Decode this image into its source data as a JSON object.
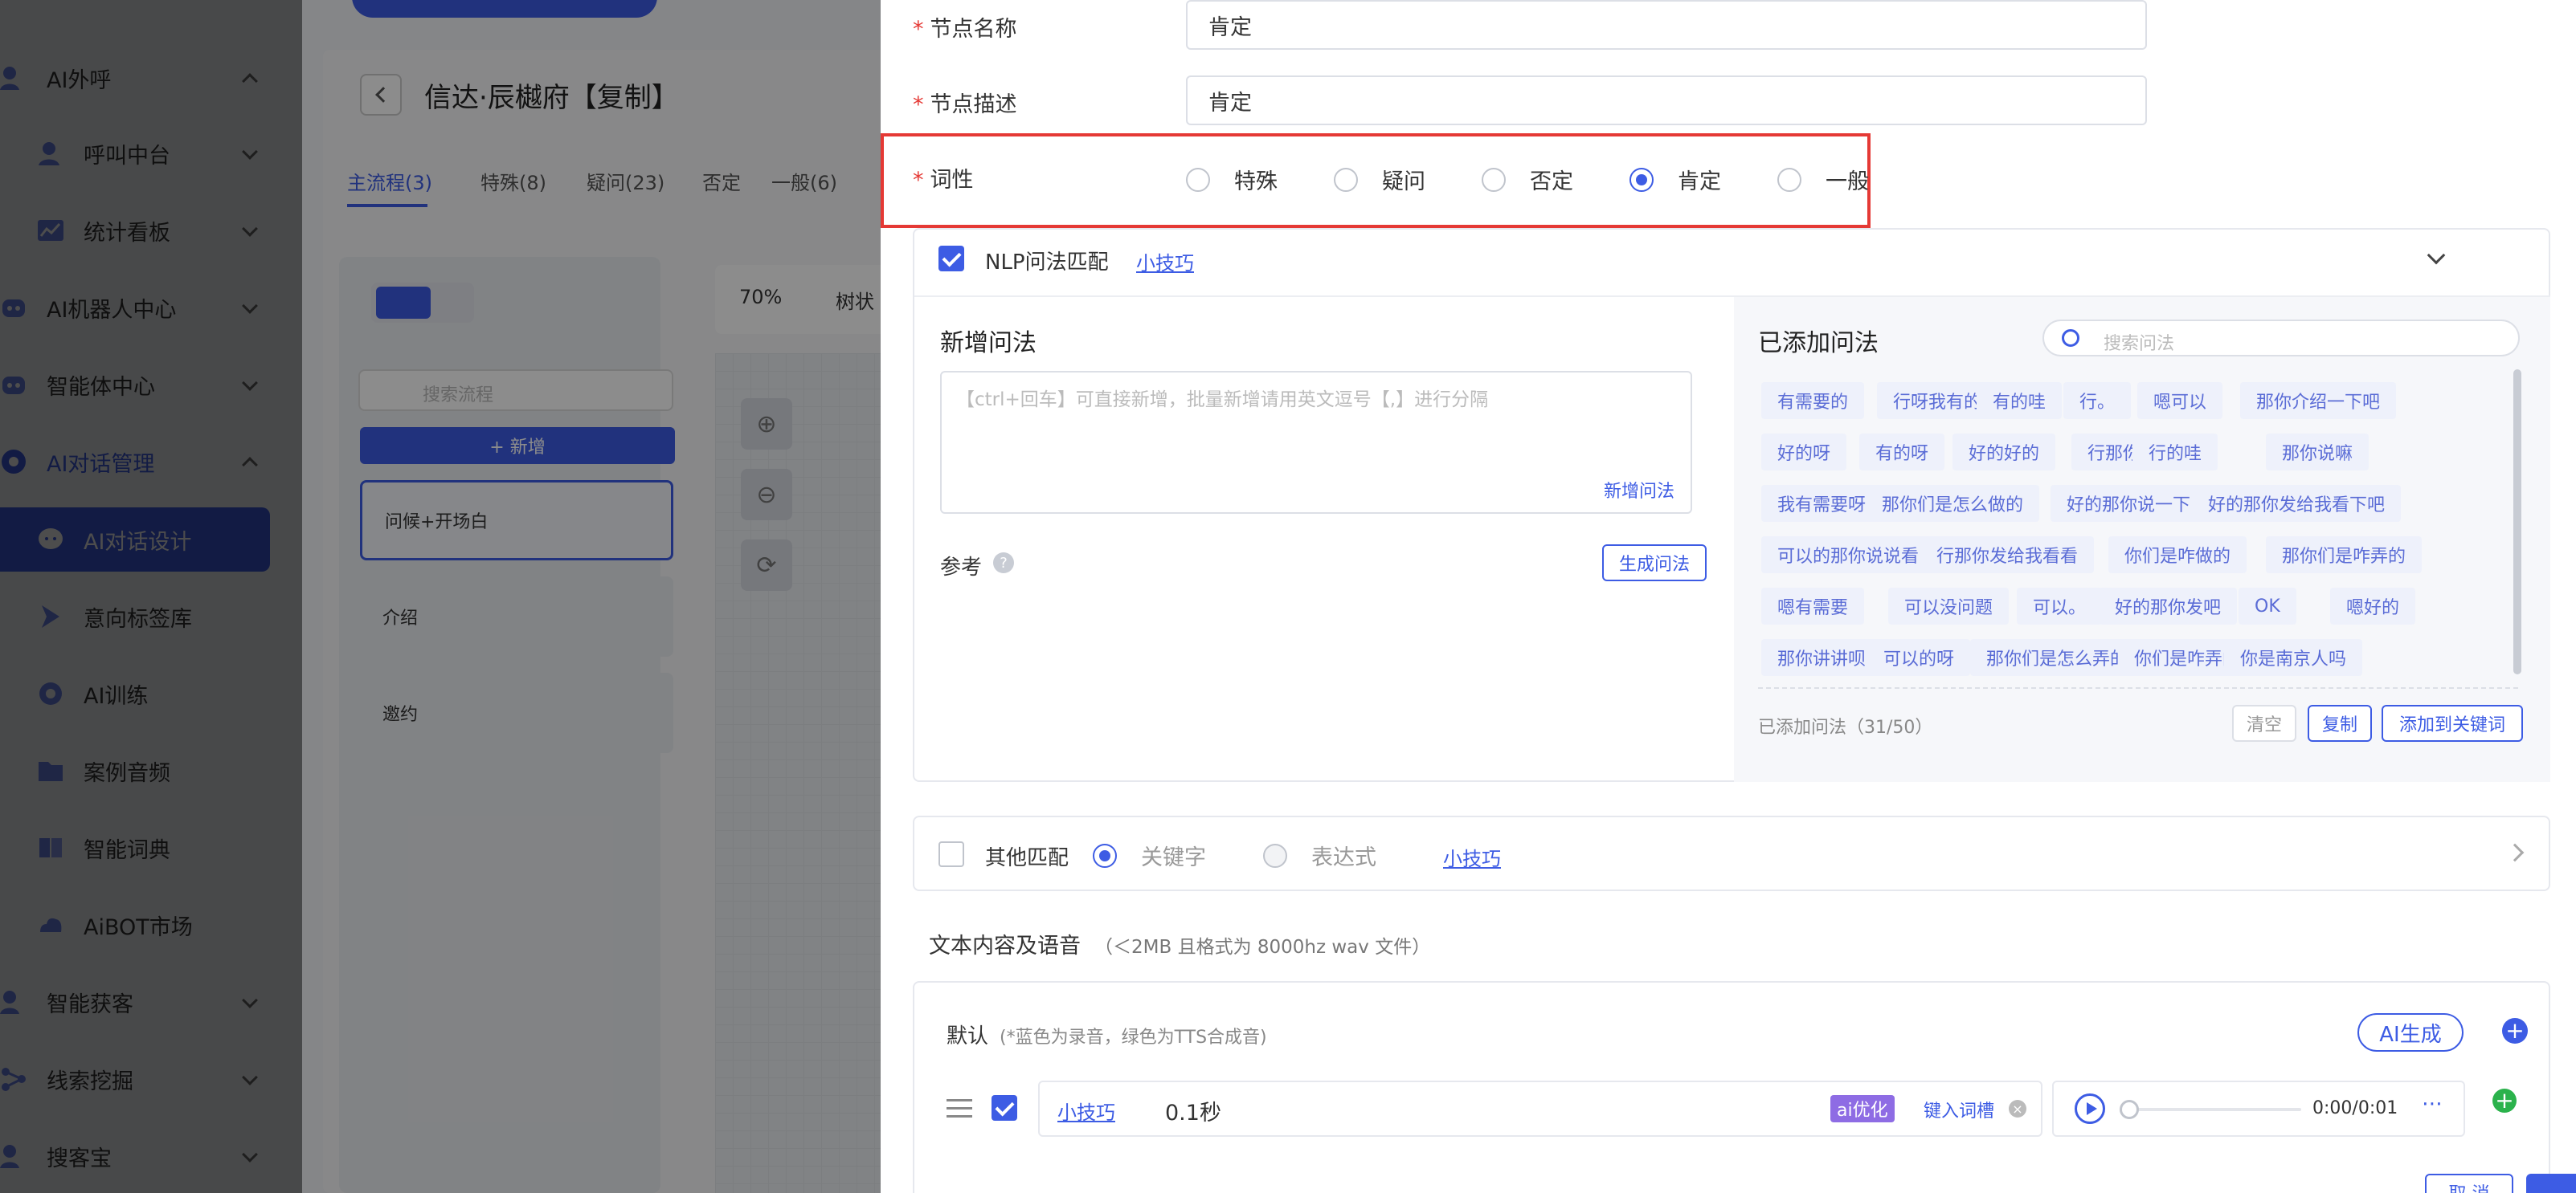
{
  "sidebar": {
    "items": [
      {
        "label": "AI外呼",
        "icon": "user-phone-icon",
        "expanded": true
      },
      {
        "label": "呼叫中台",
        "icon": "user-headset-icon",
        "expanded": false
      },
      {
        "label": "统计看板",
        "icon": "chart-board-icon",
        "expanded": false
      },
      {
        "label": "AI机器人中心",
        "icon": "robot-icon",
        "expanded": false
      },
      {
        "label": "智能体中心",
        "icon": "agent-icon",
        "expanded": false
      },
      {
        "label": "AI对话管理",
        "icon": "dialog-manage-icon",
        "expanded": true
      },
      {
        "label": "AI对话设计",
        "icon": "chat-bubble-icon",
        "active": true
      },
      {
        "label": "意向标签库",
        "icon": "tag-icon"
      },
      {
        "label": "AI训练",
        "icon": "gear-brain-icon"
      },
      {
        "label": "案例音频",
        "icon": "folder-audio-icon"
      },
      {
        "label": "智能词典",
        "icon": "book-icon"
      },
      {
        "label": "AiBOT市场",
        "icon": "cloud-market-icon"
      },
      {
        "label": "智能获客",
        "icon": "users-icon",
        "expanded": false
      },
      {
        "label": "线索挖掘",
        "icon": "flow-icon",
        "expanded": false
      },
      {
        "label": "搜客宝",
        "icon": "search-user-icon",
        "expanded": false
      }
    ]
  },
  "main": {
    "title": "信达·辰樾府【复制】",
    "tabs": [
      "主流程(3)",
      "特殊(8)",
      "疑问(23)",
      "否定",
      "一般(6)"
    ],
    "search_placeholder": "搜索流程",
    "add_label": "+ 新增",
    "flows": [
      "问候+开场白",
      "介绍",
      "邀约"
    ],
    "zoom": "70%",
    "view_mode": "树状"
  },
  "drawer": {
    "node_name_label": "节点名称",
    "node_name_value": "肯定",
    "node_desc_label": "节点描述",
    "node_desc_value": "肯定",
    "pos_label": "词性",
    "pos_options": [
      "特殊",
      "疑问",
      "否定",
      "肯定",
      "一般"
    ],
    "pos_selected": "肯定",
    "nlp": {
      "label": "NLP问法匹配",
      "tips_link": "小技巧",
      "new_title": "新增问法",
      "new_placeholder": "【ctrl+回车】可直接新增，批量新增请用英文逗号【,】进行分隔",
      "new_btn": "新增问法",
      "reference_label": "参考",
      "generate_btn": "生成问法",
      "added_title": "已添加问法",
      "search_placeholder": "搜索问法",
      "chips": [
        "有需要的",
        "行呀我有的",
        "有的哇",
        "行。",
        "嗯可以",
        "那你介绍一下吧",
        "好的呀",
        "有的呀",
        "好的好的",
        "行那你发吧",
        "行的哇",
        "那你说嘛",
        "我有需要呀",
        "那你们是怎么做的",
        "好的那你说一下",
        "好的那你发给我看下吧",
        "可以的那你说说看",
        "行那你发给我看看",
        "你们是咋做的",
        "那你们是咋弄的",
        "嗯有需要",
        "可以没问题",
        "可以。",
        "好的那你发吧",
        "OK",
        "嗯好的",
        "那你讲讲呗",
        "可以的呀",
        "那你们是怎么弄的",
        "你们是咋弄的",
        "你是南京人吗"
      ],
      "count_text": "已添加问法（31/50）",
      "clear_btn": "清空",
      "copy_btn": "复制",
      "add_keyword_btn": "添加到关键词"
    },
    "other": {
      "label": "其他匹配",
      "opt_keyword": "关键字",
      "opt_expr": "表达式",
      "tips_link": "小技巧"
    },
    "text_voice": {
      "title": "文本内容及语音",
      "hint": "（＜2MB 且格式为 8000hz wav 文件）",
      "default_label": "默认",
      "default_hint": "(*蓝色为录音，绿色为TTS合成音)",
      "ai_gen_btn": "AI生成",
      "row": {
        "tips_link": "小技巧",
        "duration": "0.1秒",
        "ai_opt": "ai优化",
        "keyin": "键入词槽",
        "time": "0:00/0:01"
      }
    },
    "footer": {
      "cancel": "取 消"
    }
  },
  "colors": {
    "accent": "#3d5ce4",
    "highlight": "#e53935",
    "success": "#2bb24c"
  }
}
